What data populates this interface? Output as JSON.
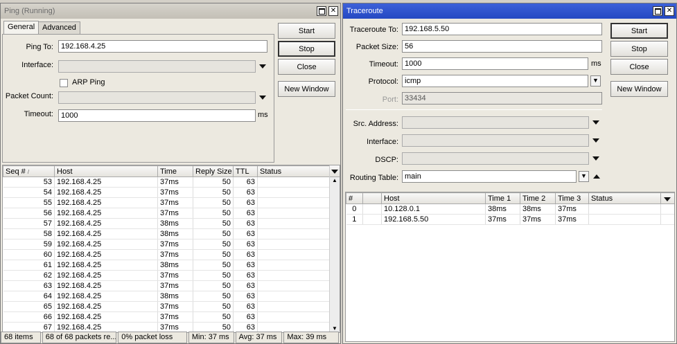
{
  "ping": {
    "title": "Ping (Running)",
    "tabs": [
      "General",
      "Advanced"
    ],
    "fields": {
      "ping_to_label": "Ping To:",
      "ping_to_value": "192.168.4.25",
      "interface_label": "Interface:",
      "interface_value": "",
      "arp_ping_label": "ARP Ping",
      "packet_count_label": "Packet Count:",
      "packet_count_value": "",
      "timeout_label": "Timeout:",
      "timeout_value": "1000",
      "timeout_unit": "ms"
    },
    "buttons": {
      "start": "Start",
      "stop": "Stop",
      "close": "Close",
      "new_window": "New Window"
    },
    "columns": [
      "Seq #",
      "Host",
      "Time",
      "Reply Size",
      "TTL",
      "Status"
    ],
    "rows": [
      {
        "seq": "53",
        "host": "192.168.4.25",
        "time": "37ms",
        "size": "50",
        "ttl": "63",
        "status": ""
      },
      {
        "seq": "54",
        "host": "192.168.4.25",
        "time": "37ms",
        "size": "50",
        "ttl": "63",
        "status": ""
      },
      {
        "seq": "55",
        "host": "192.168.4.25",
        "time": "37ms",
        "size": "50",
        "ttl": "63",
        "status": ""
      },
      {
        "seq": "56",
        "host": "192.168.4.25",
        "time": "37ms",
        "size": "50",
        "ttl": "63",
        "status": ""
      },
      {
        "seq": "57",
        "host": "192.168.4.25",
        "time": "38ms",
        "size": "50",
        "ttl": "63",
        "status": ""
      },
      {
        "seq": "58",
        "host": "192.168.4.25",
        "time": "38ms",
        "size": "50",
        "ttl": "63",
        "status": ""
      },
      {
        "seq": "59",
        "host": "192.168.4.25",
        "time": "37ms",
        "size": "50",
        "ttl": "63",
        "status": ""
      },
      {
        "seq": "60",
        "host": "192.168.4.25",
        "time": "37ms",
        "size": "50",
        "ttl": "63",
        "status": ""
      },
      {
        "seq": "61",
        "host": "192.168.4.25",
        "time": "38ms",
        "size": "50",
        "ttl": "63",
        "status": ""
      },
      {
        "seq": "62",
        "host": "192.168.4.25",
        "time": "37ms",
        "size": "50",
        "ttl": "63",
        "status": ""
      },
      {
        "seq": "63",
        "host": "192.168.4.25",
        "time": "37ms",
        "size": "50",
        "ttl": "63",
        "status": ""
      },
      {
        "seq": "64",
        "host": "192.168.4.25",
        "time": "38ms",
        "size": "50",
        "ttl": "63",
        "status": ""
      },
      {
        "seq": "65",
        "host": "192.168.4.25",
        "time": "37ms",
        "size": "50",
        "ttl": "63",
        "status": ""
      },
      {
        "seq": "66",
        "host": "192.168.4.25",
        "time": "37ms",
        "size": "50",
        "ttl": "63",
        "status": ""
      },
      {
        "seq": "67",
        "host": "192.168.4.25",
        "time": "37ms",
        "size": "50",
        "ttl": "63",
        "status": ""
      }
    ],
    "status": {
      "items": "68 items",
      "packets": "68 of 68 packets re...",
      "loss": "0% packet loss",
      "min": "Min: 37 ms",
      "avg": "Avg: 37 ms",
      "max": "Max: 39 ms"
    }
  },
  "traceroute": {
    "title": "Traceroute",
    "fields": {
      "to_label": "Traceroute To:",
      "to_value": "192.168.5.50",
      "size_label": "Packet Size:",
      "size_value": "56",
      "timeout_label": "Timeout:",
      "timeout_value": "1000",
      "timeout_unit": "ms",
      "protocol_label": "Protocol:",
      "protocol_value": "icmp",
      "port_label": "Port:",
      "port_value": "33434",
      "src_label": "Src. Address:",
      "src_value": "",
      "iface_label": "Interface:",
      "iface_value": "",
      "dscp_label": "DSCP:",
      "dscp_value": "",
      "routing_label": "Routing Table:",
      "routing_value": "main"
    },
    "buttons": {
      "start": "Start",
      "stop": "Stop",
      "close": "Close",
      "new_window": "New Window"
    },
    "columns": [
      "#",
      "",
      "Host",
      "Time 1",
      "Time 2",
      "Time 3",
      "Status"
    ],
    "rows": [
      {
        "n": "0",
        "host": "10.128.0.1",
        "t1": "38ms",
        "t2": "38ms",
        "t3": "37ms",
        "status": ""
      },
      {
        "n": "1",
        "host": "192.168.5.50",
        "t1": "37ms",
        "t2": "37ms",
        "t3": "37ms",
        "status": ""
      }
    ]
  }
}
